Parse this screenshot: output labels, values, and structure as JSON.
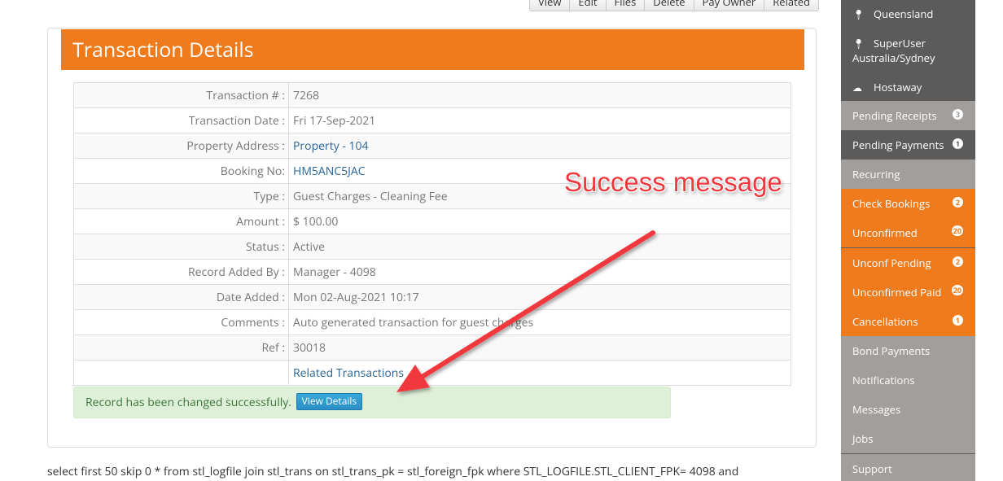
{
  "top_actions": [
    "View",
    "Edit",
    "Files",
    "Delete",
    "Pay Owner",
    "Related"
  ],
  "panel": {
    "title": "Transaction Details",
    "rows": [
      {
        "label": "Transaction # :",
        "value": "7268",
        "link": false
      },
      {
        "label": "Transaction Date :",
        "value": "Fri 17-Sep-2021",
        "link": false
      },
      {
        "label": "Property Address :",
        "value": "Property - 104",
        "link": true
      },
      {
        "label": "Booking No:",
        "value": "HM5ANC5JAC",
        "link": true
      },
      {
        "label": "Type :",
        "value": "Guest Charges - Cleaning Fee",
        "link": false
      },
      {
        "label": "Amount :",
        "value": "$ 100.00",
        "link": false
      },
      {
        "label": "Status :",
        "value": "Active",
        "link": false
      },
      {
        "label": "Record Added By :",
        "value": "Manager - 4098",
        "link": false
      },
      {
        "label": "Date Added :",
        "value": "Mon 02-Aug-2021 10:17",
        "link": false
      },
      {
        "label": "Comments :",
        "value": "Auto generated transaction for guest charges",
        "link": false
      },
      {
        "label": "Ref :",
        "value": "30018",
        "link": false
      },
      {
        "label": "",
        "value": "Related Transactions",
        "link": true
      }
    ],
    "alert": {
      "text": "Record has been changed successfully.",
      "button": "View Details"
    }
  },
  "sql_text": "select first 50 skip 0 * from stl_logfile join stl_trans on stl_trans_pk = stl_foreign_fpk where STL_LOGFILE.STL_CLIENT_FPK= 4098 and",
  "annotation": "Success message",
  "sidebar": {
    "locations": [
      {
        "icon": "map-pin-icon",
        "text": "Queensland"
      },
      {
        "icon": "map-pin-icon",
        "text": "SuperUser"
      },
      {
        "icon": "",
        "text": "Australia/Sydney"
      },
      {
        "icon": "cloud-download-icon",
        "text": "Hostaway"
      }
    ],
    "items": [
      {
        "label": "Pending Receipts",
        "badge": "3",
        "style": "grey"
      },
      {
        "label": "Pending Payments",
        "badge": "1",
        "style": "dark"
      },
      {
        "label": "Recurring",
        "badge": "",
        "style": "grey"
      },
      {
        "label": "Check Bookings",
        "badge": "2",
        "style": "orange"
      },
      {
        "label": "Unconfirmed",
        "badge": "20",
        "style": "orange"
      },
      {
        "label": "Unconf Pending",
        "badge": "2",
        "style": "orange"
      },
      {
        "label": "Unconfirmed Paid",
        "badge": "20",
        "style": "orange"
      },
      {
        "label": "Cancellations",
        "badge": "1",
        "style": "orange"
      },
      {
        "label": "Bond Payments",
        "badge": "",
        "style": "grey"
      },
      {
        "label": "Notifications",
        "badge": "",
        "style": "grey"
      },
      {
        "label": "Messages",
        "badge": "",
        "style": "grey"
      },
      {
        "label": "Jobs",
        "badge": "",
        "style": "grey"
      },
      {
        "label": "Support",
        "badge": "",
        "style": "grey"
      }
    ]
  },
  "colors": {
    "accent": "#ef7b1c",
    "success_bg": "#dff0d8",
    "link": "#2a6496",
    "annotation": "#f0393e"
  }
}
